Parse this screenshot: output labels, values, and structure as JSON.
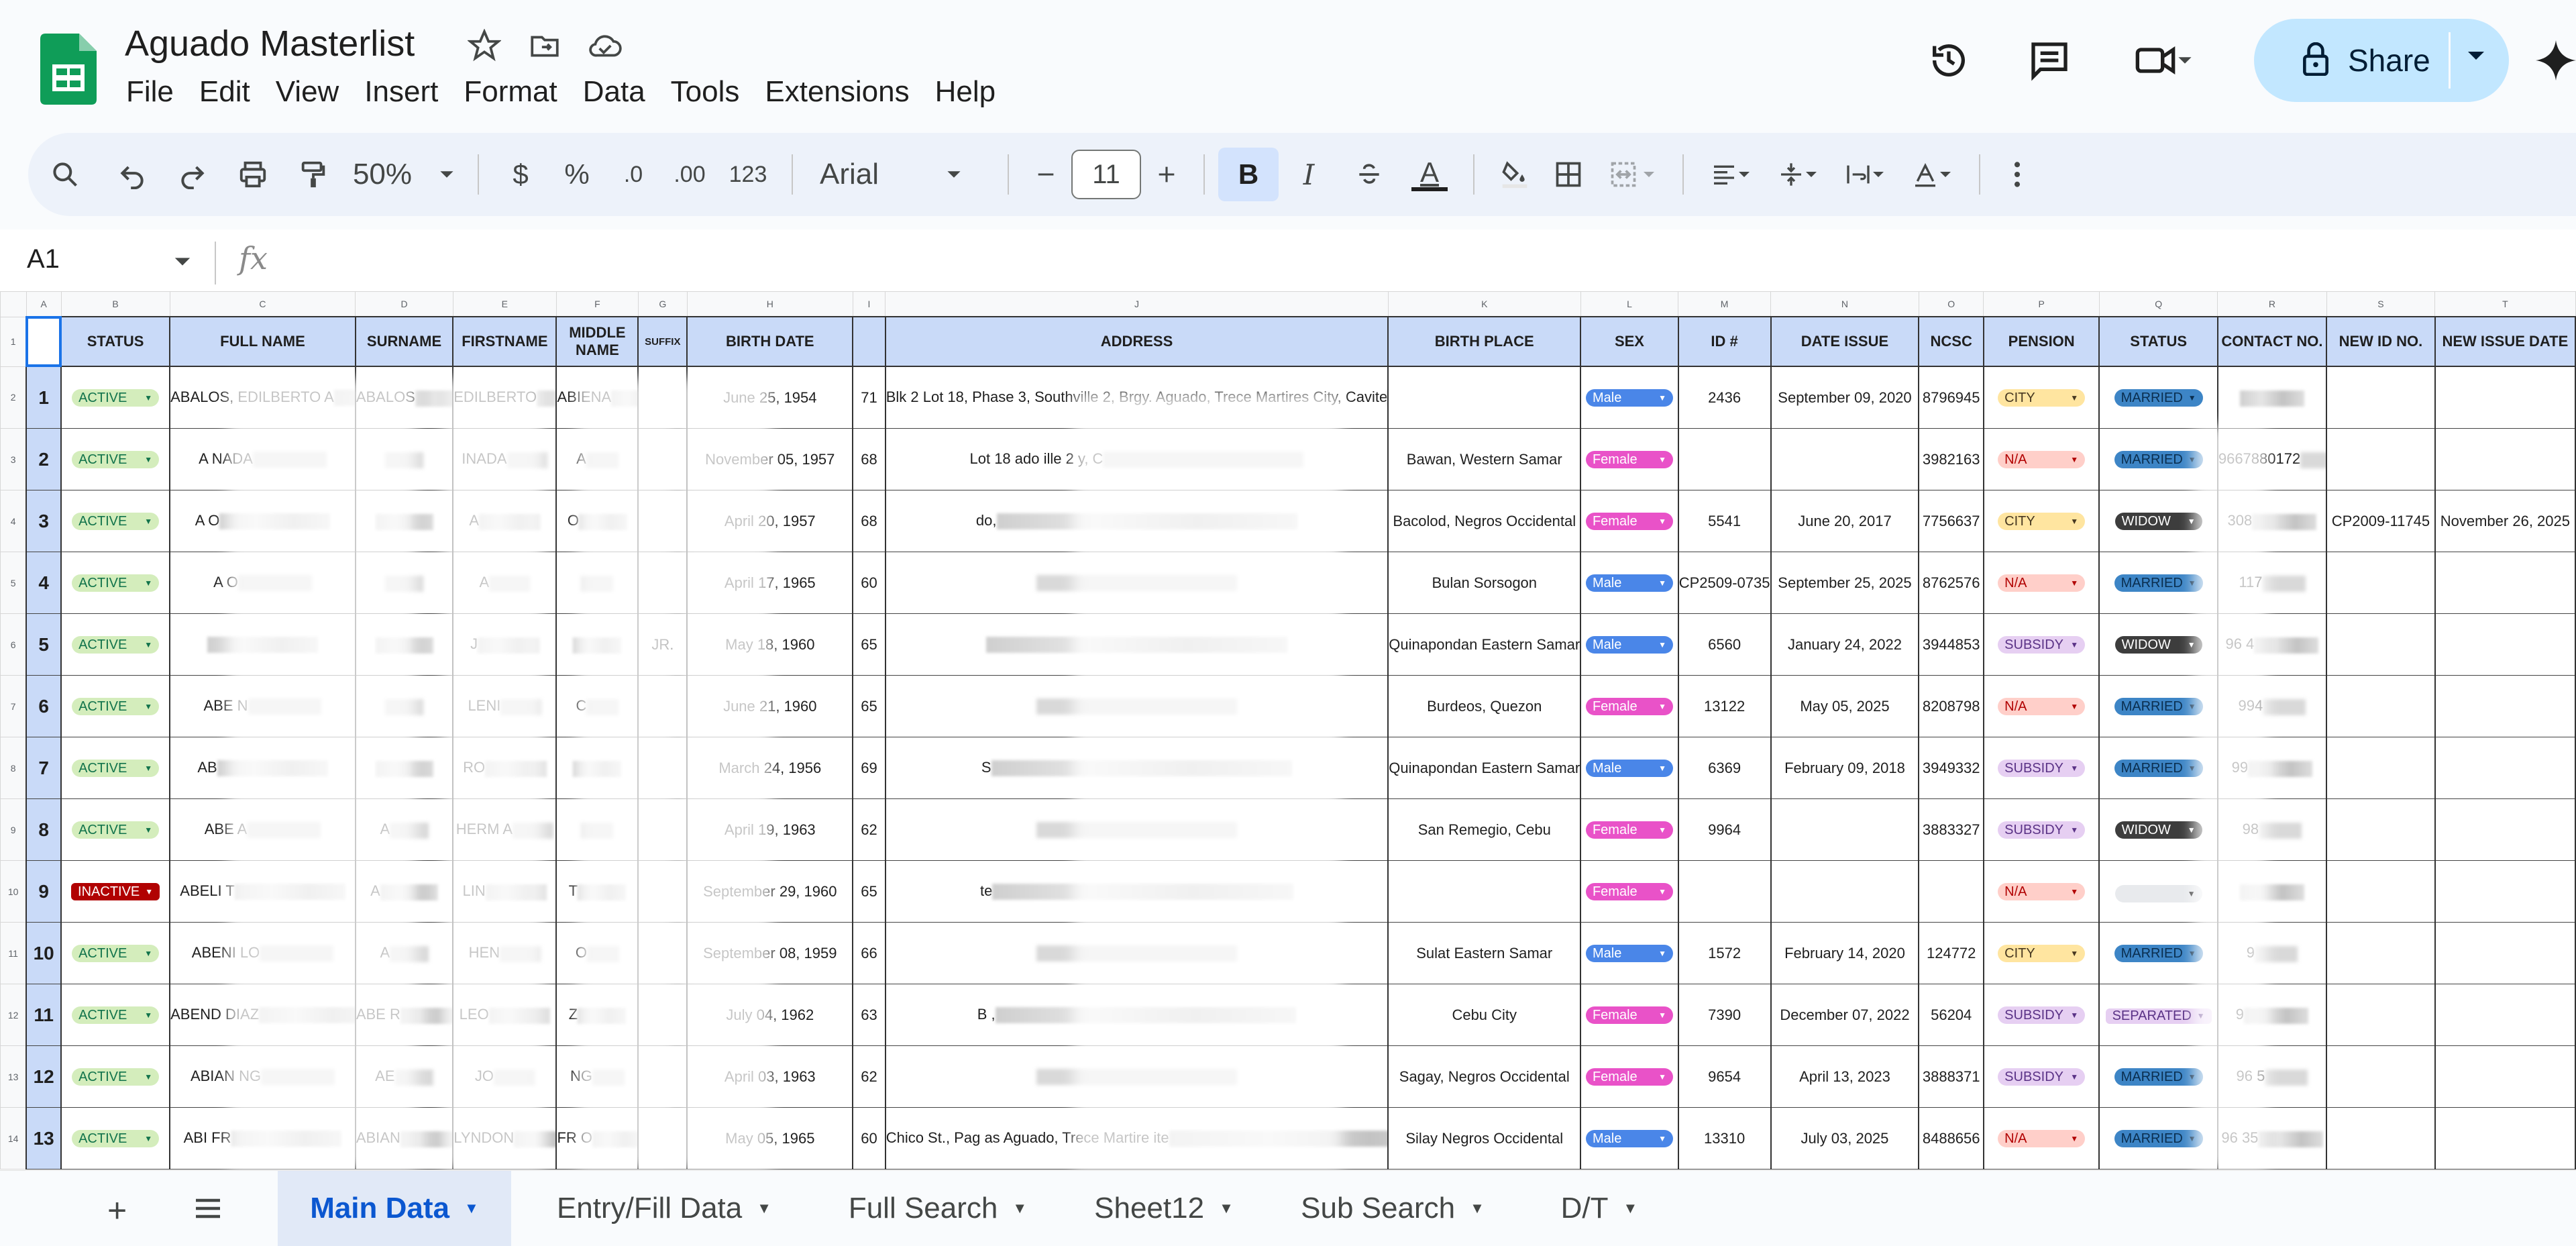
{
  "app": {
    "title": "Aguado Masterlist",
    "menu": [
      "File",
      "Edit",
      "View",
      "Insert",
      "Format",
      "Data",
      "Tools",
      "Extensions",
      "Help"
    ],
    "share_label": "Share"
  },
  "toolbar": {
    "zoom": "50%",
    "currency": "$",
    "percent": "%",
    "dec_decrease": ".0",
    "dec_increase": ".00",
    "number_format": "123",
    "font": "Arial",
    "font_size": "11",
    "bold": "B",
    "italic": "I",
    "text_color": "A"
  },
  "formula_bar": {
    "cell_ref": "A1",
    "fx": "fx"
  },
  "columns": [
    "A",
    "B",
    "C",
    "D",
    "E",
    "F",
    "G",
    "H",
    "I",
    "J",
    "K",
    "L",
    "M",
    "N",
    "O",
    "P",
    "Q",
    "R",
    "S",
    "T"
  ],
  "headers": [
    "",
    "STATUS",
    "FULL NAME",
    "SURNAME",
    "FIRSTNAME",
    "MIDDLE NAME",
    "SUFFIX",
    "BIRTH DATE",
    "",
    "ADDRESS",
    "BIRTH PLACE",
    "SEX",
    "ID #",
    "DATE ISSUE",
    "NCSC",
    "PENSION",
    "STATUS",
    "CONTACT NO.",
    "NEW ID NO.",
    "NEW ISSUE DATE"
  ],
  "rows": [
    {
      "n": "1",
      "status": "ACTIVE",
      "full": "ABALOS, EDILBERTO A",
      "sur": "ABALOS",
      "first": "EDILBERTO",
      "mid": "ABIENA",
      "suffix": "",
      "bdate": "June 25, 1954",
      "age": "71",
      "addr": "Blk 2 Lot 18, Phase 3, Southville 2, Brgy. Aguado, Trece Martires City, Cavite",
      "bplace": "",
      "sex": "Male",
      "id": "2436",
      "issue": "September 09, 2020",
      "ncsc": "8796945",
      "pension": "CITY",
      "civil": "MARRIED",
      "contact": "",
      "newid": "",
      "newdate": ""
    },
    {
      "n": "2",
      "status": "ACTIVE",
      "full": "A NADA",
      "sur": "",
      "first": "INADA",
      "mid": "A",
      "suffix": "",
      "bdate": "November 05, 1957",
      "age": "68",
      "addr": "Lot 18 ado ille 2 y, C",
      "bplace": "Bawan, Western Samar",
      "sex": "Female",
      "id": "",
      "issue": "",
      "ncsc": "3982163",
      "pension": "N/A",
      "civil": "MARRIED",
      "contact": "9667880172",
      "newid": "",
      "newdate": ""
    },
    {
      "n": "3",
      "status": "ACTIVE",
      "full": "A O",
      "sur": "",
      "first": "A",
      "mid": "O",
      "suffix": "",
      "bdate": "April 20, 1957",
      "age": "68",
      "addr": "do,",
      "bplace": "Bacolod, Negros Occidental",
      "sex": "Female",
      "id": "5541",
      "issue": "June 20, 2017",
      "ncsc": "7756637",
      "pension": "CITY",
      "civil": "WIDOW",
      "contact": "308",
      "newid": "CP2009-11745",
      "newdate": "November 26, 2025"
    },
    {
      "n": "4",
      "status": "ACTIVE",
      "full": "A O",
      "sur": "",
      "first": "A",
      "mid": "",
      "suffix": "",
      "bdate": "April 17, 1965",
      "age": "60",
      "addr": "",
      "bplace": "Bulan Sorsogon",
      "sex": "Male",
      "id": "CP2509-0735",
      "issue": "September 25, 2025",
      "ncsc": "8762576",
      "pension": "N/A",
      "civil": "MARRIED",
      "contact": "117",
      "newid": "",
      "newdate": ""
    },
    {
      "n": "5",
      "status": "ACTIVE",
      "full": "",
      "sur": "",
      "first": "J",
      "mid": "",
      "suffix": "JR.",
      "bdate": "May 18, 1960",
      "age": "65",
      "addr": "",
      "bplace": "Quinapondan Eastern Samar",
      "sex": "Male",
      "id": "6560",
      "issue": "January 24, 2022",
      "ncsc": "3944853",
      "pension": "SUBSIDY",
      "civil": "WIDOW",
      "contact": "96 4",
      "newid": "",
      "newdate": ""
    },
    {
      "n": "6",
      "status": "ACTIVE",
      "full": "ABE N",
      "sur": "",
      "first": "LENI",
      "mid": "C",
      "suffix": "",
      "bdate": "June 21, 1960",
      "age": "65",
      "addr": "",
      "bplace": "Burdeos, Quezon",
      "sex": "Female",
      "id": "13122",
      "issue": "May 05, 2025",
      "ncsc": "8208798",
      "pension": "N/A",
      "civil": "MARRIED",
      "contact": "994",
      "newid": "",
      "newdate": ""
    },
    {
      "n": "7",
      "status": "ACTIVE",
      "full": "AB",
      "sur": "",
      "first": "RO",
      "mid": "",
      "suffix": "",
      "bdate": "March 24, 1956",
      "age": "69",
      "addr": "S",
      "bplace": "Quinapondan Eastern Samar",
      "sex": "Male",
      "id": "6369",
      "issue": "February 09, 2018",
      "ncsc": "3949332",
      "pension": "SUBSIDY",
      "civil": "MARRIED",
      "contact": "99",
      "newid": "",
      "newdate": ""
    },
    {
      "n": "8",
      "status": "ACTIVE",
      "full": "ABE A",
      "sur": "A",
      "first": "HERM A",
      "mid": "",
      "suffix": "",
      "bdate": "April 19, 1963",
      "age": "62",
      "addr": "",
      "bplace": "San Remegio, Cebu",
      "sex": "Female",
      "id": "9964",
      "issue": "",
      "ncsc": "3883327",
      "pension": "SUBSIDY",
      "civil": "WIDOW",
      "contact": "98",
      "newid": "",
      "newdate": ""
    },
    {
      "n": "9",
      "status": "INACTIVE",
      "full": "ABELI T",
      "sur": "A",
      "first": "LIN",
      "mid": "T",
      "suffix": "",
      "bdate": "September 29, 1960",
      "age": "65",
      "addr": "te",
      "bplace": "",
      "sex": "Female",
      "id": "",
      "issue": "",
      "ncsc": "",
      "pension": "N/A",
      "civil": "",
      "contact": "",
      "newid": "",
      "newdate": ""
    },
    {
      "n": "10",
      "status": "ACTIVE",
      "full": "ABENI LO",
      "sur": "A",
      "first": "HEN",
      "mid": "O",
      "suffix": "",
      "bdate": "September 08, 1959",
      "age": "66",
      "addr": "",
      "bplace": "Sulat Eastern Samar",
      "sex": "Male",
      "id": "1572",
      "issue": "February 14, 2020",
      "ncsc": "124772",
      "pension": "CITY",
      "civil": "MARRIED",
      "contact": "9",
      "newid": "",
      "newdate": ""
    },
    {
      "n": "11",
      "status": "ACTIVE",
      "full": "ABEND DIAZ",
      "sur": "ABE R",
      "first": "LEO",
      "mid": "Z",
      "suffix": "",
      "bdate": "July 04, 1962",
      "age": "63",
      "addr": "B ,",
      "bplace": "Cebu City",
      "sex": "Female",
      "id": "7390",
      "issue": "December 07, 2022",
      "ncsc": "56204",
      "pension": "SUBSIDY",
      "civil": "SEPARATED",
      "contact": "9",
      "newid": "",
      "newdate": ""
    },
    {
      "n": "12",
      "status": "ACTIVE",
      "full": "ABIAN NG",
      "sur": "AE",
      "first": "JO",
      "mid": "NG",
      "suffix": "",
      "bdate": "April 03, 1963",
      "age": "62",
      "addr": "",
      "bplace": "Sagay, Negros Occidental",
      "sex": "Female",
      "id": "9654",
      "issue": "April 13, 2023",
      "ncsc": "3888371",
      "pension": "SUBSIDY",
      "civil": "MARRIED",
      "contact": "96 5",
      "newid": "",
      "newdate": ""
    },
    {
      "n": "13",
      "status": "ACTIVE",
      "full": "ABI FR",
      "sur": "ABIAN",
      "first": "LYNDON",
      "mid": "FR O",
      "suffix": "",
      "bdate": "May 05, 1965",
      "age": "60",
      "addr": "Chico St., Pag as Aguado, Trece Martire ite",
      "bplace": "Silay Negros Occidental",
      "sex": "Male",
      "id": "13310",
      "issue": "July 03, 2025",
      "ncsc": "8488656",
      "pension": "N/A",
      "civil": "MARRIED",
      "contact": "96 35",
      "newid": "",
      "newdate": ""
    }
  ],
  "chip_colors": {
    "ACTIVE": {
      "bg": "#d4edbc",
      "fg": "#11734b"
    },
    "INACTIVE": {
      "bg": "#b10202",
      "fg": "#ffffff"
    },
    "Male": {
      "bg": "#4a86e8",
      "fg": "#ffffff"
    },
    "Female": {
      "bg": "#e952c8",
      "fg": "#ffffff"
    },
    "CITY": {
      "bg": "#ffe5a0",
      "fg": "#473821"
    },
    "N/A": {
      "bg": "#ffcfc9",
      "fg": "#b10202"
    },
    "SUBSIDY": {
      "bg": "#e6cff2",
      "fg": "#5a3286"
    },
    "MARRIED": {
      "bg": "#3d85c6",
      "fg": "#0a2e4f"
    },
    "WIDOW": {
      "bg": "#3d3d3d",
      "fg": "#ffffff"
    },
    "SEPARATED": {
      "bg": "#e6cff2",
      "fg": "#5a3286"
    },
    "": {
      "bg": "#e8eaed",
      "fg": "#444"
    }
  },
  "tabs": [
    {
      "label": "Main Data",
      "active": true
    },
    {
      "label": "Entry/Fill Data",
      "active": false
    },
    {
      "label": "Full Search",
      "active": false
    },
    {
      "label": "Sheet12",
      "active": false
    },
    {
      "label": "Sub Search",
      "active": false
    },
    {
      "label": "D/T",
      "active": false
    }
  ]
}
